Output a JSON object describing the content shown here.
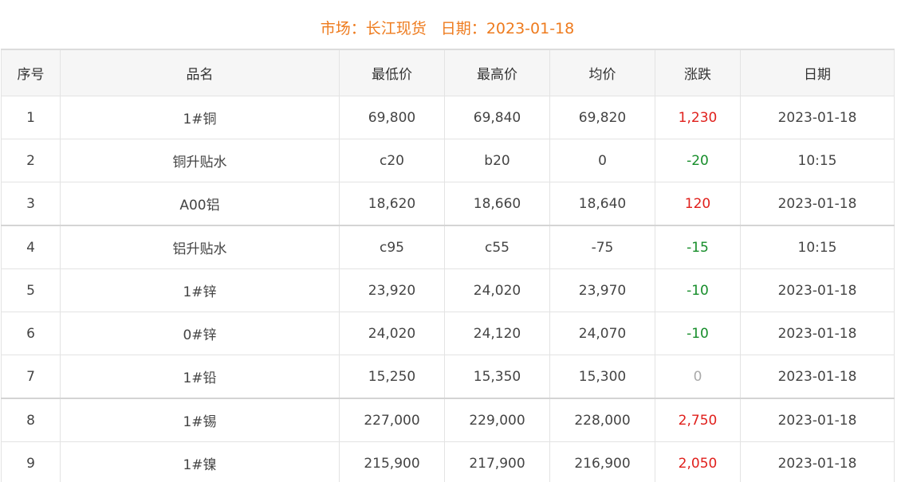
{
  "header": {
    "market_label": "市场：",
    "market": "长江现货",
    "date_label": "日期：",
    "date": "2023-01-18"
  },
  "colors": {
    "title": "#ee7b1e",
    "up": "#e0201c",
    "down": "#168d2a",
    "flat": "#aaaaaa"
  },
  "table": {
    "columns": [
      "序号",
      "品名",
      "最低价",
      "最高价",
      "均价",
      "涨跌",
      "日期"
    ],
    "rows": [
      {
        "no": "1",
        "name": "1#铜",
        "low": "69,800",
        "high": "69,840",
        "avg": "69,820",
        "change": "1,230",
        "trend": "up",
        "date": "2023-01-18"
      },
      {
        "no": "2",
        "name": "铜升贴水",
        "low": "c20",
        "high": "b20",
        "avg": "0",
        "change": "-20",
        "trend": "down",
        "date": "10:15"
      },
      {
        "no": "3",
        "name": "A00铝",
        "low": "18,620",
        "high": "18,660",
        "avg": "18,640",
        "change": "120",
        "trend": "up",
        "date": "2023-01-18"
      },
      {
        "no": "4",
        "name": "铝升贴水",
        "low": "c95",
        "high": "c55",
        "avg": "-75",
        "change": "-15",
        "trend": "down",
        "date": "10:15"
      },
      {
        "no": "5",
        "name": "1#锌",
        "low": "23,920",
        "high": "24,020",
        "avg": "23,970",
        "change": "-10",
        "trend": "down",
        "date": "2023-01-18"
      },
      {
        "no": "6",
        "name": "0#锌",
        "low": "24,020",
        "high": "24,120",
        "avg": "24,070",
        "change": "-10",
        "trend": "down",
        "date": "2023-01-18"
      },
      {
        "no": "7",
        "name": "1#铅",
        "low": "15,250",
        "high": "15,350",
        "avg": "15,300",
        "change": "0",
        "trend": "flat",
        "date": "2023-01-18"
      },
      {
        "no": "8",
        "name": "1#锡",
        "low": "227,000",
        "high": "229,000",
        "avg": "228,000",
        "change": "2,750",
        "trend": "up",
        "date": "2023-01-18"
      },
      {
        "no": "9",
        "name": "1#镍",
        "low": "215,900",
        "high": "217,900",
        "avg": "216,900",
        "change": "2,050",
        "trend": "up",
        "date": "2023-01-18"
      }
    ]
  }
}
